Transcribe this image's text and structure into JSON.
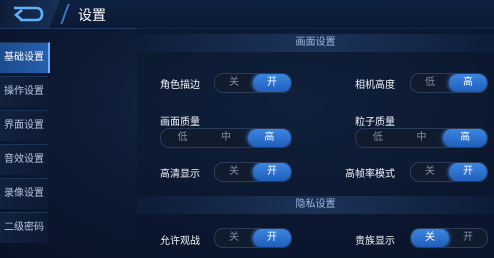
{
  "header": {
    "title": "设置"
  },
  "sidebar": {
    "items": [
      {
        "label": "基础设置",
        "active": true
      },
      {
        "label": "操作设置",
        "active": false
      },
      {
        "label": "界面设置",
        "active": false
      },
      {
        "label": "音效设置",
        "active": false
      },
      {
        "label": "录像设置",
        "active": false
      },
      {
        "label": "二级密码",
        "active": false
      }
    ]
  },
  "sections": {
    "graphics": {
      "title": "画面设置"
    },
    "privacy": {
      "title": "隐私设置"
    }
  },
  "settings": {
    "character_outline": {
      "label": "角色描边",
      "options": [
        "关",
        "开"
      ],
      "selected": "开"
    },
    "camera_height": {
      "label": "相机高度",
      "options": [
        "低",
        "高"
      ],
      "selected": "高"
    },
    "graphics_quality": {
      "label": "画面质量",
      "options": [
        "低",
        "中",
        "高"
      ],
      "selected": "高"
    },
    "particle_quality": {
      "label": "粒子质量",
      "options": [
        "低",
        "中",
        "高"
      ],
      "selected": "高"
    },
    "hd_display": {
      "label": "高清显示",
      "options": [
        "关",
        "开"
      ],
      "selected": "开"
    },
    "high_fps_mode": {
      "label": "高帧率模式",
      "options": [
        "关",
        "开"
      ],
      "selected": "开"
    },
    "allow_spectate": {
      "label": "允许观战",
      "options": [
        "关",
        "开"
      ],
      "selected": "开"
    },
    "noble_display": {
      "label": "贵族显示",
      "options": [
        "关",
        "开"
      ],
      "selected": "关"
    }
  },
  "colors": {
    "accent": "#2f74d0",
    "background": "#0d1a33"
  },
  "icons": {
    "back": "back-arrow-icon"
  }
}
